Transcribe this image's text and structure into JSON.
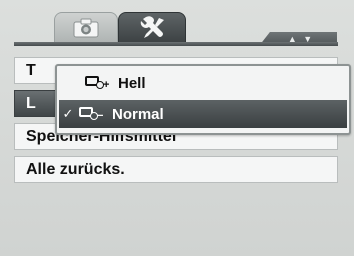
{
  "tabs": [
    {
      "icon": "camera-icon",
      "active": false
    },
    {
      "icon": "wrench-screwdriver-icon",
      "active": true
    }
  ],
  "scroll_arrows": "▲ ▼",
  "menu": {
    "items": [
      {
        "label": "T"
      },
      {
        "label": "L",
        "selected": true
      },
      {
        "label": "Speicher-Hilfsmittel"
      },
      {
        "label": "Alle zurücks."
      }
    ]
  },
  "popup": {
    "options": [
      {
        "label": "Hell",
        "icon": "lcd-bright-icon",
        "sign": "+",
        "checked": false
      },
      {
        "label": "Normal",
        "icon": "lcd-normal-icon",
        "sign": "−",
        "checked": true,
        "check_mark": "✓"
      }
    ]
  },
  "colors": {
    "background": "#d3d6d4",
    "highlight": "#3f4547",
    "row_bg": "#f5f6f6"
  }
}
